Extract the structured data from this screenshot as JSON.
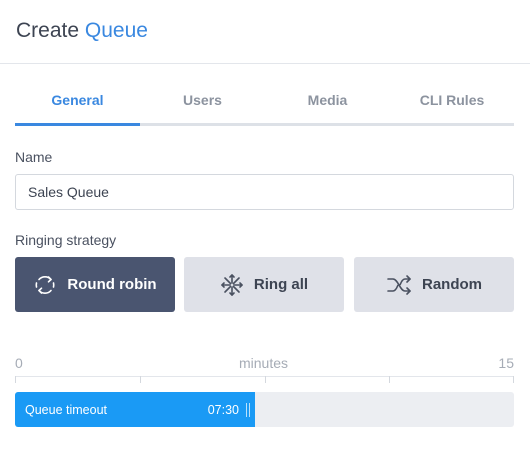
{
  "header": {
    "title_prefix": "Create",
    "title_accent": "Queue"
  },
  "tabs": [
    {
      "label": "General",
      "active": true
    },
    {
      "label": "Users",
      "active": false
    },
    {
      "label": "Media",
      "active": false
    },
    {
      "label": "CLI Rules",
      "active": false
    }
  ],
  "name_field": {
    "label": "Name",
    "value": "Sales Queue"
  },
  "ringing_strategy": {
    "label": "Ringing strategy",
    "options": [
      {
        "label": "Round robin",
        "icon": "round-robin-icon",
        "selected": true
      },
      {
        "label": "Ring all",
        "icon": "ring-all-icon",
        "selected": false
      },
      {
        "label": "Random",
        "icon": "shuffle-icon",
        "selected": false
      }
    ]
  },
  "timeout": {
    "scale_min": "0",
    "scale_unit": "minutes",
    "scale_max": "15",
    "label": "Queue timeout",
    "value": "07:30",
    "fraction": 0.48
  },
  "colors": {
    "accent": "#3a88e0",
    "selected_button": "#4a5570",
    "slider_fill": "#1a9af5"
  }
}
